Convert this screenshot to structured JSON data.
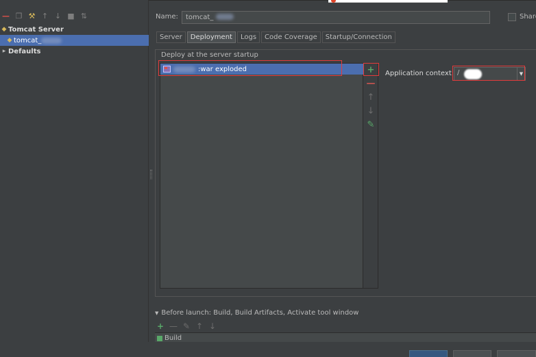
{
  "left": {
    "toolbar_icons": [
      "minus-icon",
      "copy-icon",
      "wrench-icon",
      "arrow-up-icon",
      "arrow-down-icon",
      "folder-icon",
      "sort-icon"
    ],
    "tree": {
      "group_label": "Tomcat Server",
      "config_label": "tomcat_",
      "defaults_label": "Defaults"
    }
  },
  "form": {
    "name_label": "Name:",
    "name_value": "tomcat_",
    "share_label": "Share"
  },
  "tabs": [
    {
      "label": "Server"
    },
    {
      "label": "Deployment",
      "active": true
    },
    {
      "label": "Logs"
    },
    {
      "label": "Code Coverage"
    },
    {
      "label": "Startup/Connection"
    }
  ],
  "deployment": {
    "group_title": "Deploy at the server startup",
    "items": [
      {
        "label": ":war exploded",
        "selected": true
      }
    ],
    "side_buttons": [
      "add-icon",
      "remove-icon",
      "move-up-icon",
      "move-down-icon",
      "edit-icon"
    ],
    "app_context_label": "Application context:",
    "app_context_value": "/"
  },
  "before_launch": {
    "label": "Before launch: Build, Build Artifacts, Activate tool window",
    "items": [
      {
        "label": "Build"
      }
    ]
  },
  "colors": {
    "background": "#3c3f41",
    "selection": "#4b6eaf",
    "field_background": "#45494a",
    "add_green": "#59a869",
    "remove_red": "#c75450",
    "highlight_red": "#e53b3b"
  }
}
